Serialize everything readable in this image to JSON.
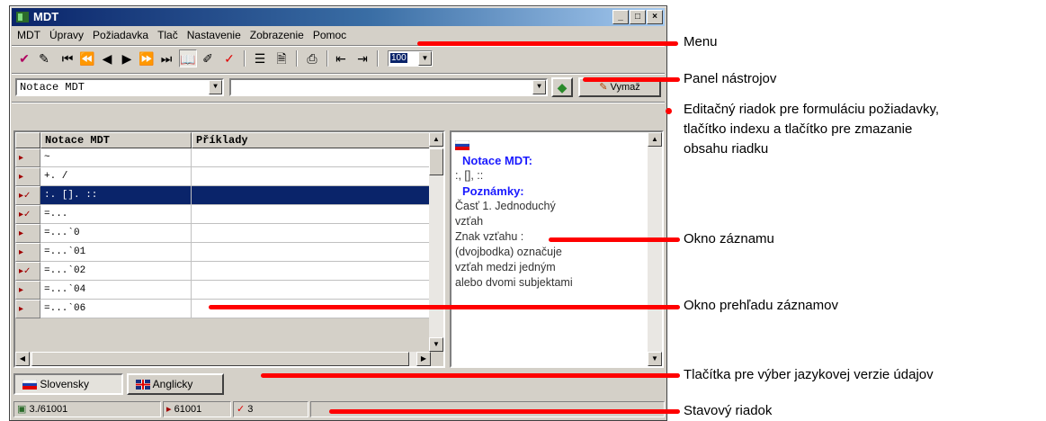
{
  "window": {
    "title": "MDT",
    "minimize": "_",
    "maximize": "□",
    "close": "×"
  },
  "menu": [
    "MDT",
    "Úpravy",
    "Požiadavka",
    "Tlač",
    "Nastavenie",
    "Zobrazenie",
    "Pomoc"
  ],
  "toolbar": {
    "icons": [
      "tag-check-icon",
      "edit-note-icon",
      "first-record-icon",
      "previous-page-icon",
      "previous-record-icon",
      "next-record-icon",
      "next-page-icon",
      "last-record-icon",
      "book-icon",
      "highlighter-icon",
      "checkmark-icon",
      "list-icon",
      "document-icon",
      "print-icon",
      "import-icon",
      "export-icon"
    ],
    "zoom_value": "100"
  },
  "editrow": {
    "field_combo": "Notace MDT",
    "query_value": "",
    "clear_button": "Vymaž"
  },
  "grid": {
    "columns": [
      "Notace MDT",
      "Příklady"
    ],
    "rows": [
      {
        "mark": "▸",
        "notation": "~",
        "example": ""
      },
      {
        "mark": "▸",
        "notation": "+. /",
        "example": ""
      },
      {
        "mark": "▸✓",
        "notation": ":. []. ::",
        "example": "",
        "selected": true
      },
      {
        "mark": "▸✓",
        "notation": "=...",
        "example": ""
      },
      {
        "mark": "▸",
        "notation": "=...`0",
        "example": ""
      },
      {
        "mark": "▸",
        "notation": "=...`01",
        "example": ""
      },
      {
        "mark": "▸✓",
        "notation": "=...`02",
        "example": ""
      },
      {
        "mark": "▸",
        "notation": "=...`04",
        "example": ""
      },
      {
        "mark": "▸",
        "notation": "=...`06",
        "example": ""
      }
    ]
  },
  "record": {
    "heading1": "Notace MDT:",
    "notation": ":, [], ::",
    "heading2": "Poznámky:",
    "line1": "Časť 1. Jednoduchý",
    "line2": "vzťah",
    "line3": "Znak vzťahu :",
    "line4": "(dvojbodka) označuje",
    "line5": "vzťah medzi jedným",
    "line6": "alebo dvomi subjektami"
  },
  "language_tabs": [
    "Slovensky",
    "Anglicky"
  ],
  "status": {
    "record_pos": "3./61001",
    "count": "61001",
    "checked": "3"
  },
  "annotations": {
    "menu": "Menu",
    "toolbar": "Panel nástrojov",
    "editrow_1": "Editačný riadok pre formuláciu požiadavky,",
    "editrow_2": "tlačítko indexu a tlačítko pre zmazanie",
    "editrow_3": "obsahu riadku",
    "record": "Okno záznamu",
    "overview": "Okno prehľadu záznamov",
    "language": "Tlačítka pre výber jazykovej verzie údajov",
    "status": "Stavový riadok"
  },
  "colors": {
    "accent": "#0a246a",
    "annotation_line": "#ff0000",
    "heading_blue": "#1a1aff"
  }
}
